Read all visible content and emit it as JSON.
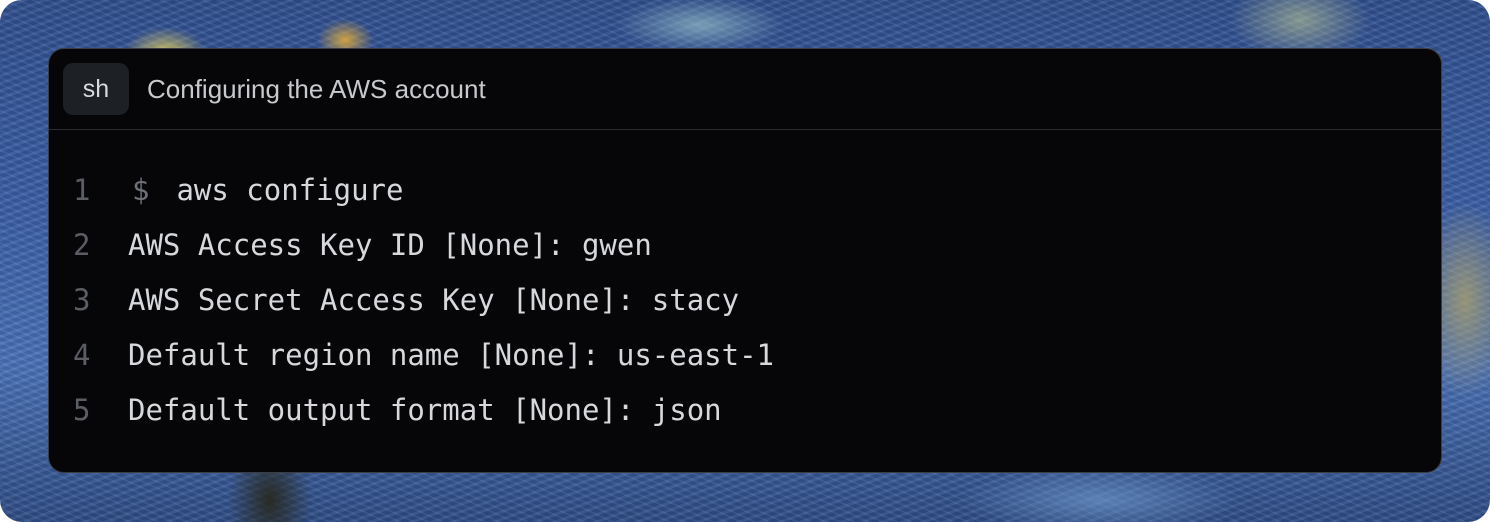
{
  "header": {
    "language_badge": "sh",
    "title": "Configuring the AWS account"
  },
  "code": {
    "lines": [
      {
        "number": "1",
        "prompt": "$",
        "text": "aws configure"
      },
      {
        "number": "2",
        "text": "AWS Access Key ID [None]: gwen"
      },
      {
        "number": "3",
        "text": "AWS Secret Access Key [None]: stacy"
      },
      {
        "number": "4",
        "text": "Default region name [None]: us-east-1"
      },
      {
        "number": "5",
        "text": "Default output format [None]: json"
      }
    ]
  }
}
